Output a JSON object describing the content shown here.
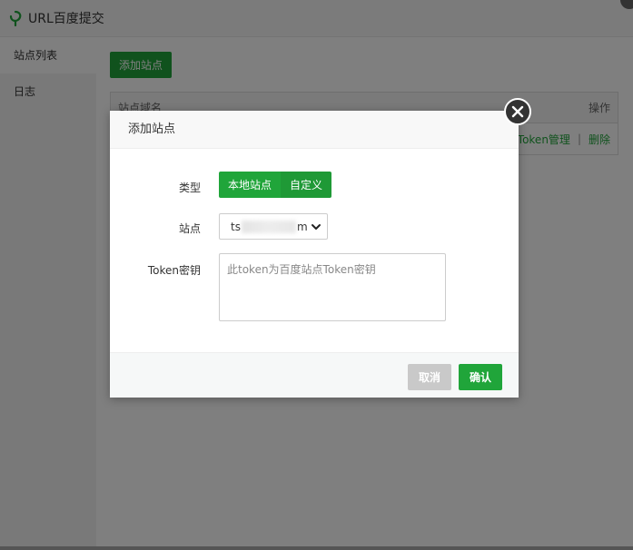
{
  "app": {
    "title": "URL百度提交",
    "logo_icon": "leaf-logo-icon"
  },
  "sidebar": {
    "items": [
      {
        "label": "站点列表",
        "active": true
      },
      {
        "label": "日志",
        "active": false
      }
    ]
  },
  "main": {
    "add_site_label": "添加站点",
    "table": {
      "col_domain": "站点域名",
      "col_actions": "操作",
      "row_token_link": "Token管理",
      "row_separator": "|",
      "row_delete_link": "删除"
    }
  },
  "modal": {
    "title": "添加站点",
    "close_icon": "close-icon",
    "type_label": "类型",
    "type_options": [
      "本地站点",
      "自定义"
    ],
    "type_selected": "本地站点",
    "site_label": "站点",
    "site_value_prefix": "ts",
    "site_value_suffix": "m",
    "token_label": "Token密钥",
    "token_placeholder": "此token为百度站点Token密钥",
    "token_value": "",
    "cancel_label": "取消",
    "confirm_label": "确认"
  },
  "colors": {
    "primary_green": "#20a53a",
    "cancel_gray": "#c9c9c9"
  }
}
